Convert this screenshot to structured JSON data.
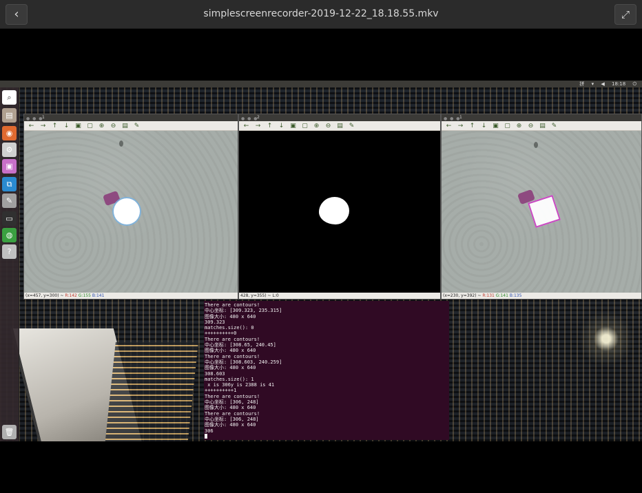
{
  "player": {
    "title": "simplescreenrecorder-2019-12-22_18.18.55.mkv",
    "back_icon": "back-arrow-icon",
    "fullscreen_icon": "fullscreen-icon"
  },
  "ubuntu_panel": {
    "clock": "18:18",
    "keyboard": "拼"
  },
  "launcher": {
    "apps": [
      {
        "name": "search-icon",
        "glyph": "⌕",
        "color": "#ffffff"
      },
      {
        "name": "files-icon",
        "glyph": "▤",
        "color": "#b0a090"
      },
      {
        "name": "firefox-icon",
        "glyph": "◉",
        "color": "#e06a30"
      },
      {
        "name": "settings-icon",
        "glyph": "⚙",
        "color": "#d0d0d0"
      },
      {
        "name": "image-viewer-icon",
        "glyph": "▣",
        "color": "#c870c8"
      },
      {
        "name": "vscode-icon",
        "glyph": "⧉",
        "color": "#2a8ad0"
      },
      {
        "name": "text-editor-icon",
        "glyph": "✎",
        "color": "#a0a0a0"
      },
      {
        "name": "terminal-icon",
        "glyph": "▭",
        "color": "#303030"
      },
      {
        "name": "globe-icon",
        "glyph": "◍",
        "color": "#3aa040"
      },
      {
        "name": "help-icon",
        "glyph": "?",
        "color": "#c0c0c0"
      },
      {
        "name": "trash-icon",
        "glyph": "🗑",
        "color": "#b0b0b0"
      }
    ]
  },
  "windows": [
    {
      "title": "1",
      "status_prefix": "(x=457, y=300) ~ ",
      "r": "R:142",
      "g": "G:155",
      "b": "B:141"
    },
    {
      "title": "2",
      "status_prefix": "428, y=355) ~ L:0"
    },
    {
      "title": "1",
      "status_prefix": "(x=230, y=392) ~ ",
      "r": "R:131",
      "g": "G:141",
      "b": "B:135"
    }
  ],
  "terminal": {
    "lines": [
      "There are contours!",
      "中心坐标: [309.323, 235.315]",
      "图像大小: 480 x 640",
      "309.323",
      "matches.size(): 0",
      "++++++++++0",
      "There are contours!",
      "中心坐标: [308.65, 240.45]",
      "图像大小: 480 x 640",
      "There are contours!",
      "中心坐标: [308.603, 240.259]",
      "图像大小: 480 x 640",
      "308.603",
      "matches.size(): 1",
      " x is 306y is 2388 is 41",
      "++++++++++1",
      "There are contours!",
      "中心坐标: [306, 248]",
      "图像大小: 480 x 640",
      "There are contours!",
      "中心坐标: [306, 248]",
      "图像大小: 480 x 640",
      "306"
    ]
  }
}
